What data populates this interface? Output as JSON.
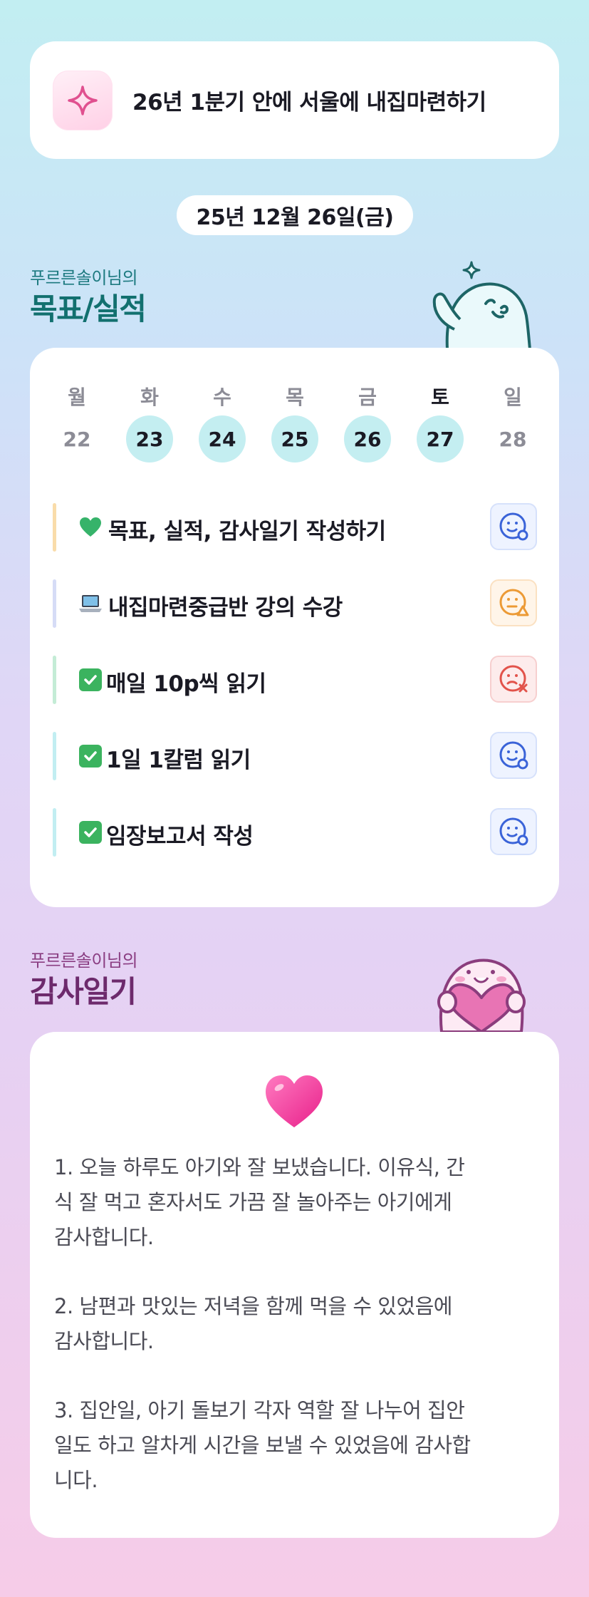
{
  "goal": {
    "text": "26년 1분기 안에 서울에 내집마련하기",
    "icon": "sparkle-icon"
  },
  "date": "25년 12월 26일(금)",
  "goals_section": {
    "subtitle": "푸르른솔이님의",
    "title": "목표/실적"
  },
  "weekdays": [
    "월",
    "화",
    "수",
    "목",
    "금",
    "토",
    "일"
  ],
  "days": [
    {
      "num": "22",
      "active": false
    },
    {
      "num": "23",
      "active": true
    },
    {
      "num": "24",
      "active": true
    },
    {
      "num": "25",
      "active": true
    },
    {
      "num": "26",
      "active": true
    },
    {
      "num": "27",
      "active": true
    },
    {
      "num": "28",
      "active": false
    }
  ],
  "goal_items": [
    {
      "emoji": "green-heart-icon",
      "label": "목표, 실적, 감사일기 작성하기",
      "bar_color": "#f9dcaa",
      "status": "good",
      "status_icon": "smile-face-icon"
    },
    {
      "emoji": "laptop-icon",
      "label": "내집마련중급반 강의 수강",
      "bar_color": "#d6dcf6",
      "status": "mid",
      "status_icon": "neutral-face-warning-icon"
    },
    {
      "emoji": "check-box-icon",
      "label": "매일 10p씩 읽기",
      "bar_color": "#c4ecd6",
      "status": "bad",
      "status_icon": "sad-face-x-icon"
    },
    {
      "emoji": "check-box-icon",
      "label": "1일 1칼럼 읽기",
      "bar_color": "#c2eef2",
      "status": "good",
      "status_icon": "smile-face-icon"
    },
    {
      "emoji": "check-box-icon",
      "label": "임장보고서 작성",
      "bar_color": "#c2eef2",
      "status": "good",
      "status_icon": "smile-face-icon"
    }
  ],
  "colors": {
    "good": "#3a63d8",
    "mid": "#ec9a35",
    "bad": "#e2534b",
    "teal_title": "#12706f",
    "purple_title": "#6d2a6c"
  },
  "thanks_section": {
    "subtitle": "푸르른솔이님의",
    "title": "감사일기"
  },
  "thanks_entries": [
    "1. 오늘 하루도 아기와 잘 보냈습니다. 이유식, 간\n식 잘 먹고 혼자서도 가끔 잘 놀아주는 아기에게\n감사합니다.",
    "2. 남편과 맛있는 저녁을 함께 먹을 수 있었음에\n감사합니다.",
    "3. 집안일, 아기 돌보기 각자 역할 잘 나누어 집안\n일도 하고 알차게 시간을 보낼 수 있었음에 감사합\n니다."
  ]
}
